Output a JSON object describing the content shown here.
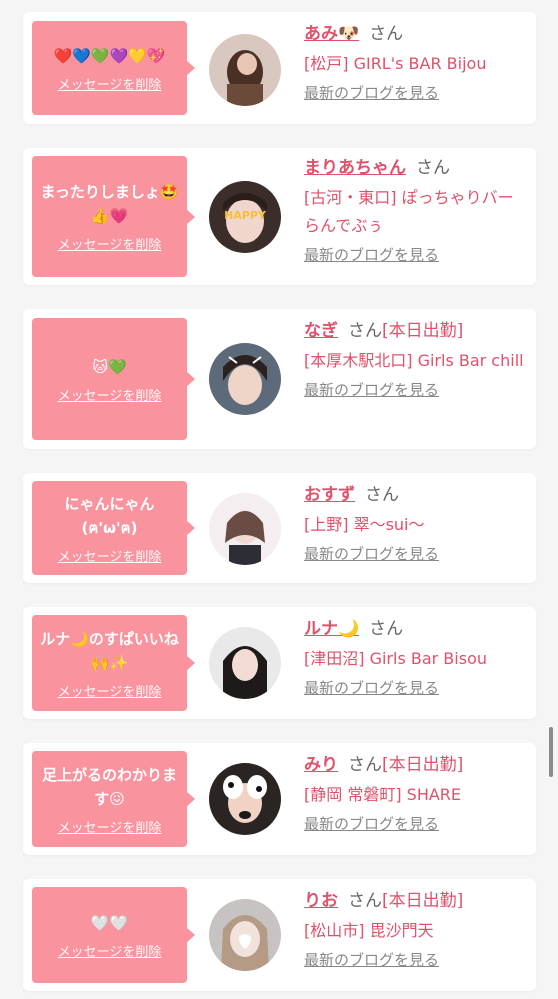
{
  "colors": {
    "accent": "#e0516b",
    "bubble": "#f9949f",
    "background": "#f5f5f6"
  },
  "delete_label": "メッセージを削除",
  "blog_label": "最新のブログを見る",
  "san_label": "さん",
  "messages": [
    {
      "message": "❤️💙💚💜💛💖",
      "name": "あみ🐶",
      "status": "",
      "shop": "[松戸] GIRL's BAR Bijou"
    },
    {
      "message": "まったりしましょ🤩👍💗",
      "name": "まりあちゃん",
      "status": "",
      "shop": "[古河・東口] ぽっちゃりバー らんでぶぅ"
    },
    {
      "message": "🐱💚",
      "name": "なぎ",
      "status": "[本日出勤]",
      "shop": "[本厚木駅北口] Girls Bar chill"
    },
    {
      "message": "にゃんにゃん(ฅ'ω'ฅ)",
      "name": "おすず",
      "status": "",
      "shop": "[上野] 翠〜sui〜"
    },
    {
      "message": "ルナ🌙のすぱいいね🙌✨",
      "name": "ルナ🌙",
      "status": "",
      "shop": "[津田沼] Girls Bar Bisou"
    },
    {
      "message": "足上がるのわかります😖",
      "name": "みり",
      "status": "[本日出勤]",
      "shop": "[静岡 常磐町] SHARE"
    },
    {
      "message": "🤍🤍",
      "name": "りお",
      "status": "[本日出勤]",
      "shop": "[松山市] 毘沙門天"
    }
  ]
}
